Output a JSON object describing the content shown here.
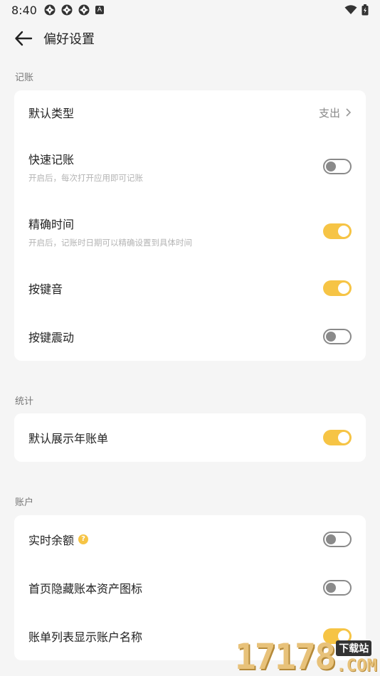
{
  "status_bar": {
    "time": "8:40",
    "badge": "A"
  },
  "header": {
    "title": "偏好设置"
  },
  "sections": [
    {
      "label": "记账",
      "items": [
        {
          "title": "默认类型",
          "value": "支出",
          "type": "link"
        },
        {
          "title": "快速记账",
          "subtitle": "开启后，每次打开应用即可记账",
          "type": "toggle",
          "on": false
        },
        {
          "title": "精确时间",
          "subtitle": "开启后，记账时日期可以精确设置到具体时间",
          "type": "toggle",
          "on": true
        },
        {
          "title": "按键音",
          "type": "toggle",
          "on": true
        },
        {
          "title": "按键震动",
          "type": "toggle",
          "on": false
        }
      ]
    },
    {
      "label": "统计",
      "items": [
        {
          "title": "默认展示年账单",
          "type": "toggle",
          "on": true
        }
      ]
    },
    {
      "label": "账户",
      "items": [
        {
          "title": "实时余额",
          "type": "toggle",
          "on": false,
          "help_icon": "question-icon",
          "help_text": "?"
        },
        {
          "title": "首页隐藏账本资产图标",
          "type": "toggle",
          "on": false
        },
        {
          "title": "账单列表显示账户名称",
          "type": "toggle",
          "on": true
        }
      ]
    }
  ],
  "watermark": {
    "number": "17178",
    "tag": "下载站",
    "domain": ".COM"
  },
  "colors": {
    "accent": "#f6c445",
    "background": "#f5f5f5",
    "card": "#ffffff"
  }
}
